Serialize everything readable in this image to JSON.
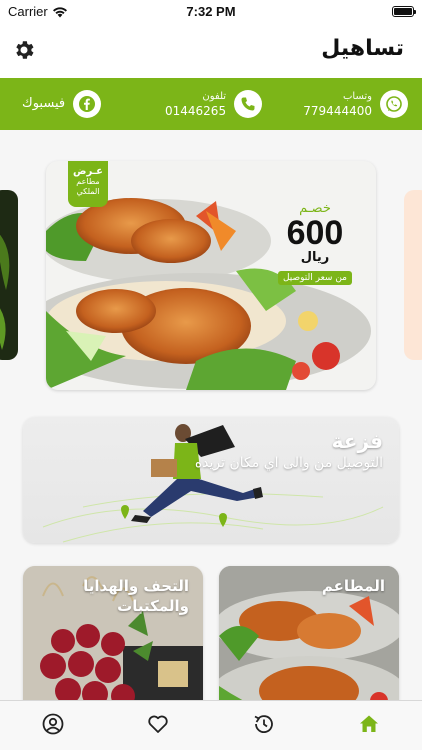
{
  "status_bar": {
    "carrier": "Carrier",
    "time": "7:32 PM"
  },
  "header": {
    "title": "تساهيل",
    "settings_icon": "gear-icon"
  },
  "contact_bar": {
    "background": "#7cb518",
    "whatsapp": {
      "label": "وتساب",
      "number": "779444400",
      "icon": "whatsapp-icon"
    },
    "phone": {
      "label": "تلفون",
      "number": "01446265",
      "icon": "phone-icon"
    },
    "facebook": {
      "label": "فيسبوك",
      "icon": "facebook-icon"
    }
  },
  "banner": {
    "promo_tag": {
      "line1": "عـرض",
      "line2": "مطاعم",
      "line3": "الملكي"
    },
    "discount": {
      "prefix": "خصـم",
      "amount": "600",
      "currency": "ريال",
      "note": "من سعر التوصيل"
    }
  },
  "delivery_card": {
    "title": "فزعة",
    "subtitle": "التوصيل من والى اي مكان تريده"
  },
  "categories": [
    {
      "label_line1": "التحف والهدايا",
      "label_line2": "والمكتبات"
    },
    {
      "label_line1": "المطاعم",
      "label_line2": ""
    }
  ],
  "tab_bar": {
    "accent": "#7cb518",
    "tabs": [
      {
        "icon": "profile-icon"
      },
      {
        "icon": "heart-icon"
      },
      {
        "icon": "history-icon"
      },
      {
        "icon": "home-icon",
        "active": true
      }
    ]
  }
}
